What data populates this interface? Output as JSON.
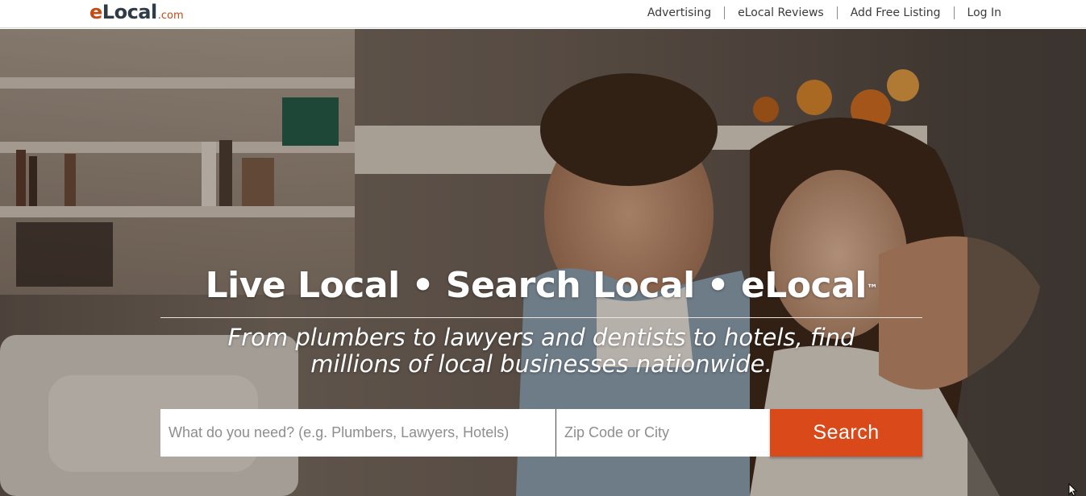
{
  "header": {
    "logo": {
      "main": "Local",
      "e": "e",
      "suffix": ".com"
    },
    "nav": [
      "Advertising",
      "eLocal Reviews",
      "Add Free Listing",
      "Log In"
    ]
  },
  "hero": {
    "headline": "Live Local • Search Local • eLocal",
    "trademark": "™",
    "tagline_line1": "From plumbers to lawyers and dentists to hotels, find",
    "tagline_line2": "millions of local businesses nationwide."
  },
  "search": {
    "what_placeholder": "What do you need? (e.g. Plumbers, Lawyers, Hotels)",
    "where_placeholder": "Zip Code or City",
    "button_label": "Search"
  },
  "colors": {
    "brand_orange": "#d9491a",
    "logo_dark": "#2e3c47"
  }
}
